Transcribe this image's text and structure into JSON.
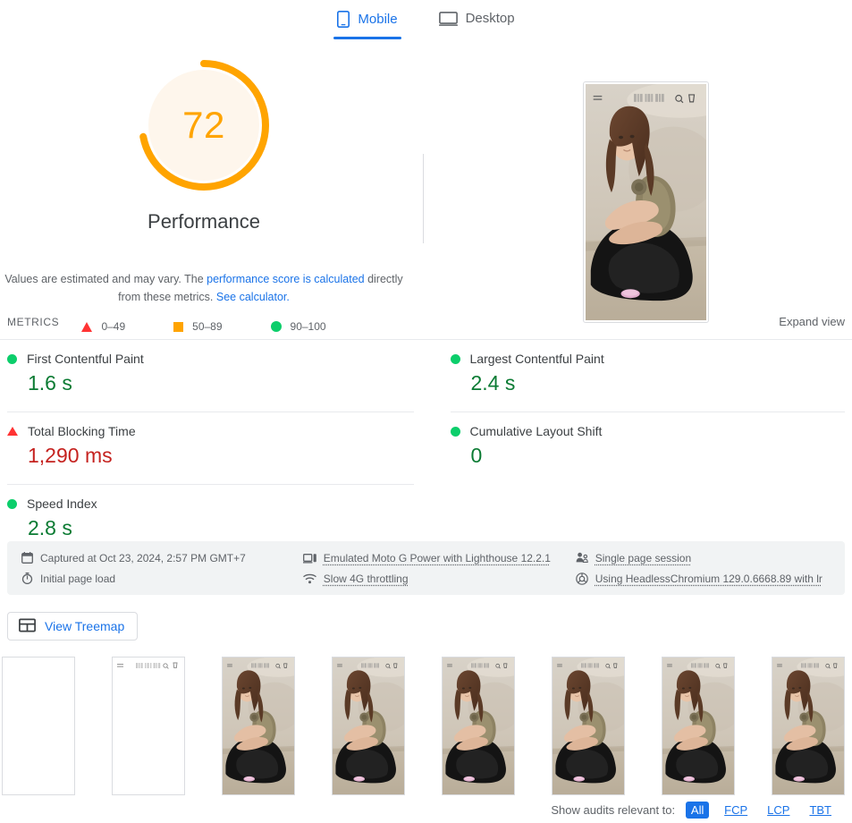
{
  "tabs": [
    {
      "label": "Mobile",
      "icon": "mobile-icon",
      "active": true
    },
    {
      "label": "Desktop",
      "icon": "desktop-icon",
      "active": false
    }
  ],
  "score": {
    "value": "72",
    "category": "Performance",
    "percent": 72,
    "color": "#ffa400",
    "track_color": "#fef6ec"
  },
  "description": {
    "before": "Values are estimated and may vary. The ",
    "link1": "performance score is calculated",
    "middle": " directly from these metrics. ",
    "link2": "See calculator."
  },
  "legend": [
    {
      "shape": "triangle",
      "label": "0–49",
      "color": "#ff3333"
    },
    {
      "shape": "square",
      "label": "50–89",
      "color": "#ffa400"
    },
    {
      "shape": "circle",
      "label": "90–100",
      "color": "#0cce6b"
    }
  ],
  "metrics_section": {
    "heading": "METRICS",
    "expand_label": "Expand view"
  },
  "metrics": {
    "left": [
      {
        "name": "First Contentful Paint",
        "value": "1.6 s",
        "shape": "circle",
        "status": "pass"
      },
      {
        "name": "Total Blocking Time",
        "value": "1,290 ms",
        "shape": "triangle",
        "status": "fail"
      },
      {
        "name": "Speed Index",
        "value": "2.8 s",
        "shape": "circle",
        "status": "pass"
      }
    ],
    "right": [
      {
        "name": "Largest Contentful Paint",
        "value": "2.4 s",
        "shape": "circle",
        "status": "pass"
      },
      {
        "name": "Cumulative Layout Shift",
        "value": "0",
        "shape": "circle",
        "status": "pass"
      }
    ]
  },
  "environment": [
    {
      "icon": "calendar-icon",
      "label": "Captured at Oct 23, 2024, 2:57 PM GMT+7",
      "dotted": false
    },
    {
      "icon": "stopwatch-icon",
      "label": "Initial page load",
      "dotted": false
    },
    {
      "icon": "device-icon",
      "label": "Emulated Moto G Power with Lighthouse 12.2.1",
      "dotted": true
    },
    {
      "icon": "wifi-icon",
      "label": "Slow 4G throttling",
      "dotted": true
    },
    {
      "icon": "users-icon",
      "label": "Single page session",
      "dotted": true
    },
    {
      "icon": "chromium-icon",
      "label": "Using HeadlessChromium 129.0.6668.89 with lr",
      "dotted": true
    }
  ],
  "treemap": {
    "label": "View Treemap",
    "icon": "treemap-icon"
  },
  "filmstrip": [
    {
      "state": "blank"
    },
    {
      "state": "header-only"
    },
    {
      "state": "full"
    },
    {
      "state": "full"
    },
    {
      "state": "full"
    },
    {
      "state": "full"
    },
    {
      "state": "full"
    },
    {
      "state": "full"
    }
  ],
  "audit_filter": {
    "label": "Show audits relevant to:",
    "options": [
      {
        "label": "All",
        "selected": true
      },
      {
        "label": "FCP",
        "selected": false
      },
      {
        "label": "LCP",
        "selected": false
      },
      {
        "label": "TBT",
        "selected": false
      }
    ]
  },
  "screenshot": {
    "alt": "Fashion e-commerce page, woman seated in olive top and black skirt",
    "nav_icons": [
      "menu-icon",
      "search-icon",
      "cart-icon"
    ]
  }
}
